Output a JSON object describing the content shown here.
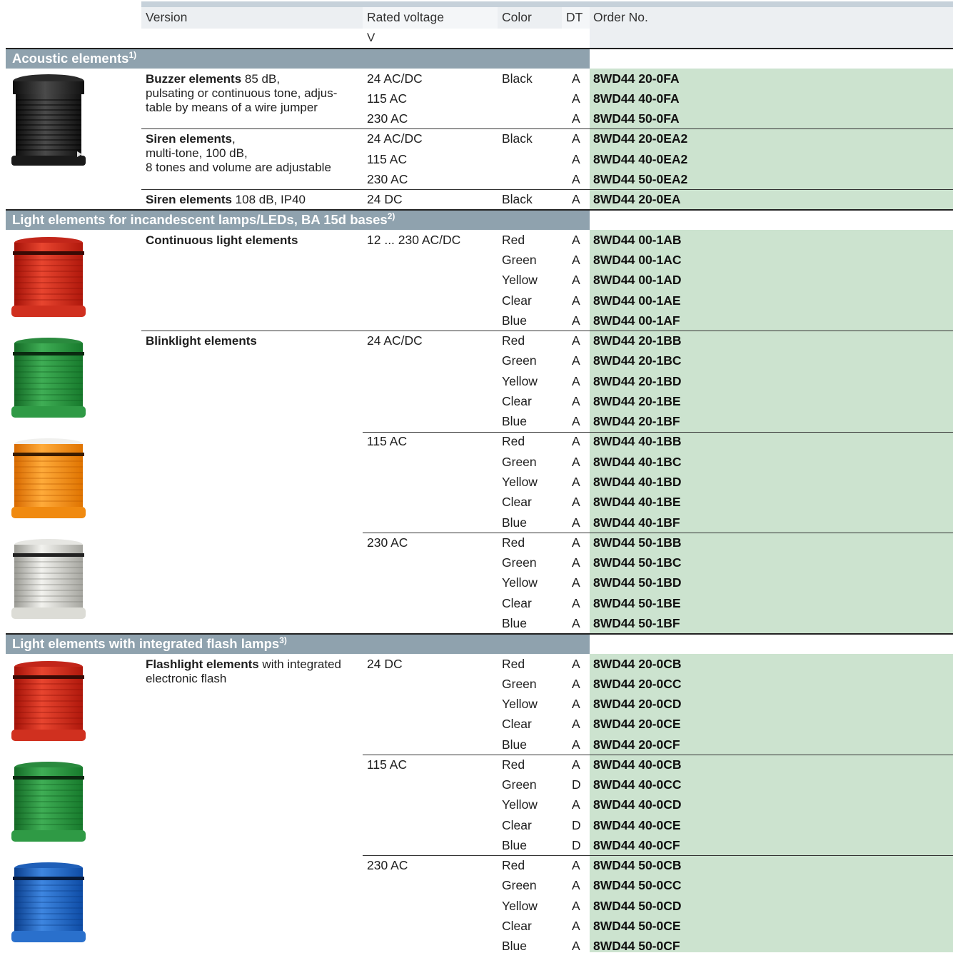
{
  "header": {
    "version": "Version",
    "rated_voltage": "Rated voltage",
    "voltage_unit": "V",
    "color": "Color",
    "dt": "DT",
    "order_no": "Order No."
  },
  "sections": {
    "acoustic": {
      "title": "Acoustic elements",
      "note": "1)"
    },
    "incandescent": {
      "title": "Light elements for incandescent lamps/LEDs, BA 15d bases",
      "note": "2)"
    },
    "flash": {
      "title": "Light elements with integrated flash lamps",
      "note": "3)"
    }
  },
  "products": {
    "buzzer": {
      "name": "Buzzer elements",
      "l1": " 85 dB,",
      "l2": "pulsating or continuous tone, adjus-",
      "l3": "table by means of a wire jumper"
    },
    "siren": {
      "name": "Siren elements",
      "l1": ",",
      "l2": "multi-tone, 100 dB,",
      "l3": "8 tones and volume are adjustable"
    },
    "siren2": {
      "name": "Siren elements",
      "l1": " 108 dB, IP40"
    },
    "continuous": {
      "name": "Continuous light elements"
    },
    "blink": {
      "name": "Blinklight elements"
    },
    "flashlight": {
      "name": "Flashlight elements",
      "l1": " with integrated",
      "l2": "electronic flash"
    }
  },
  "rows": [
    {
      "v": "24 AC/DC",
      "c": "Black",
      "dt": "A",
      "o": "8WD44 20-0FA"
    },
    {
      "v": "115 AC",
      "c": "",
      "dt": "A",
      "o": "8WD44 40-0FA"
    },
    {
      "v": "230 AC",
      "c": "",
      "dt": "A",
      "o": "8WD44 50-0FA"
    },
    {
      "v": "24 AC/DC",
      "c": "Black",
      "dt": "A",
      "o": "8WD44 20-0EA2"
    },
    {
      "v": "115 AC",
      "c": "",
      "dt": "A",
      "o": "8WD44 40-0EA2"
    },
    {
      "v": "230 AC",
      "c": "",
      "dt": "A",
      "o": "8WD44 50-0EA2"
    },
    {
      "v": "24 DC",
      "c": "Black",
      "dt": "A",
      "o": "8WD44 20-0EA"
    },
    {
      "v": "12 ... 230 AC/DC",
      "c": "Red",
      "dt": "A",
      "o": "8WD44 00-1AB"
    },
    {
      "v": "",
      "c": "Green",
      "dt": "A",
      "o": "8WD44 00-1AC"
    },
    {
      "v": "",
      "c": "Yellow",
      "dt": "A",
      "o": "8WD44 00-1AD"
    },
    {
      "v": "",
      "c": "Clear",
      "dt": "A",
      "o": "8WD44 00-1AE"
    },
    {
      "v": "",
      "c": "Blue",
      "dt": "A",
      "o": "8WD44 00-1AF"
    },
    {
      "v": "24 AC/DC",
      "c": "Red",
      "dt": "A",
      "o": "8WD44 20-1BB"
    },
    {
      "v": "",
      "c": "Green",
      "dt": "A",
      "o": "8WD44 20-1BC"
    },
    {
      "v": "",
      "c": "Yellow",
      "dt": "A",
      "o": "8WD44 20-1BD"
    },
    {
      "v": "",
      "c": "Clear",
      "dt": "A",
      "o": "8WD44 20-1BE"
    },
    {
      "v": "",
      "c": "Blue",
      "dt": "A",
      "o": "8WD44 20-1BF"
    },
    {
      "v": "115 AC",
      "c": "Red",
      "dt": "A",
      "o": "8WD44 40-1BB"
    },
    {
      "v": "",
      "c": "Green",
      "dt": "A",
      "o": "8WD44 40-1BC"
    },
    {
      "v": "",
      "c": "Yellow",
      "dt": "A",
      "o": "8WD44 40-1BD"
    },
    {
      "v": "",
      "c": "Clear",
      "dt": "A",
      "o": "8WD44 40-1BE"
    },
    {
      "v": "",
      "c": "Blue",
      "dt": "A",
      "o": "8WD44 40-1BF"
    },
    {
      "v": "230 AC",
      "c": "Red",
      "dt": "A",
      "o": "8WD44 50-1BB"
    },
    {
      "v": "",
      "c": "Green",
      "dt": "A",
      "o": "8WD44 50-1BC"
    },
    {
      "v": "",
      "c": "Yellow",
      "dt": "A",
      "o": "8WD44 50-1BD"
    },
    {
      "v": "",
      "c": "Clear",
      "dt": "A",
      "o": "8WD44 50-1BE"
    },
    {
      "v": "",
      "c": "Blue",
      "dt": "A",
      "o": "8WD44 50-1BF"
    },
    {
      "v": "24 DC",
      "c": "Red",
      "dt": "A",
      "o": "8WD44 20-0CB"
    },
    {
      "v": "",
      "c": "Green",
      "dt": "A",
      "o": "8WD44 20-0CC"
    },
    {
      "v": "",
      "c": "Yellow",
      "dt": "A",
      "o": "8WD44 20-0CD"
    },
    {
      "v": "",
      "c": "Clear",
      "dt": "A",
      "o": "8WD44 20-0CE"
    },
    {
      "v": "",
      "c": "Blue",
      "dt": "A",
      "o": "8WD44 20-0CF"
    },
    {
      "v": "115 AC",
      "c": "Red",
      "dt": "A",
      "o": "8WD44 40-0CB"
    },
    {
      "v": "",
      "c": "Green",
      "dt": "D",
      "o": "8WD44 40-0CC"
    },
    {
      "v": "",
      "c": "Yellow",
      "dt": "A",
      "o": "8WD44 40-0CD"
    },
    {
      "v": "",
      "c": "Clear",
      "dt": "D",
      "o": "8WD44 40-0CE"
    },
    {
      "v": "",
      "c": "Blue",
      "dt": "D",
      "o": "8WD44 40-0CF"
    },
    {
      "v": "230 AC",
      "c": "Red",
      "dt": "A",
      "o": "8WD44 50-0CB"
    },
    {
      "v": "",
      "c": "Green",
      "dt": "A",
      "o": "8WD44 50-0CC"
    },
    {
      "v": "",
      "c": "Yellow",
      "dt": "A",
      "o": "8WD44 50-0CD"
    },
    {
      "v": "",
      "c": "Clear",
      "dt": "A",
      "o": "8WD44 50-0CE"
    },
    {
      "v": "",
      "c": "Blue",
      "dt": "A",
      "o": "8WD44 50-0CF"
    }
  ],
  "colors": {
    "order_bg": "#cce3cf",
    "section_bg": "#8fa2ae",
    "header_bg": "#eceff2"
  }
}
